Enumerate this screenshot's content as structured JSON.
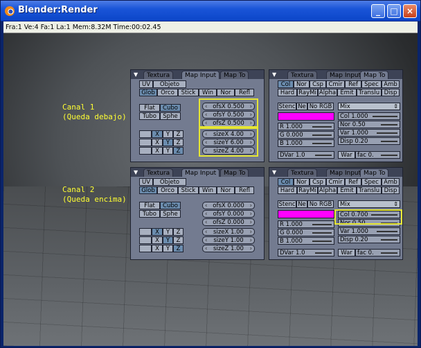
{
  "window": {
    "title": "Blender:Render",
    "status": "Fra:1  Ve:4 Fa:1 La:1 Mem:8.32M Time:00:02.45"
  },
  "labels": {
    "canal1": [
      "Canal 1",
      "(Queda debajo)"
    ],
    "canal2": [
      "Canal 2",
      "(Queda encima)"
    ]
  },
  "tabs_left": [
    "Textura",
    "Map Input",
    "Map To"
  ],
  "tabs_right": [
    "Textura",
    "Map Input",
    "Map To"
  ],
  "mapinput": {
    "uv": "UV",
    "objeto": "Objeto",
    "coords": [
      "Glob",
      "Orco",
      "Stick",
      "Win",
      "Nor",
      "Refl"
    ],
    "flat": "Flat",
    "cubo": "Cubo",
    "tubo": "Tubo",
    "sphe": "Sphe",
    "xyz": [
      "X",
      "Y",
      "Z"
    ]
  },
  "mapinput1": {
    "ofs": [
      "ofsX 0.500",
      "ofsY 0.500",
      "ofsZ 0.500"
    ],
    "size": [
      "sizeX 4.00",
      "sizeY 6.00",
      "sizeZ 4.00"
    ]
  },
  "mapinput2": {
    "ofs": [
      "ofsX 0.000",
      "ofsY 0.000",
      "ofsZ 0.000"
    ],
    "size": [
      "sizeX 1.00",
      "sizeY 1.00",
      "sizeZ 1.00"
    ]
  },
  "mapto": {
    "row1": [
      "Col",
      "Nor",
      "Csp",
      "Cmir",
      "Ref",
      "Spec",
      "Amb"
    ],
    "row2": [
      "Hard",
      "RayMi",
      "Alpha",
      "Emit",
      "Translu",
      "Disp"
    ],
    "stenc": "Stenc",
    "ne": "Ne",
    "norgb": "No RGB",
    "mix": "Mix",
    "war": "War",
    "dvar": "DVar 1.0",
    "fac": "fac 0.",
    "color": "#ff00ff",
    "rgb": [
      "R 1.000",
      "G 0.000",
      "B 1.000"
    ]
  },
  "mapto1": {
    "col": "Col 1.000",
    "nor": "Nor 0.50",
    "var": "Var 1.000",
    "disp": "Disp 0.20"
  },
  "mapto2": {
    "col": "Col 0.700",
    "nor": "Nor 0.50",
    "var": "Var 1.000",
    "disp": "Disp 0.20"
  }
}
